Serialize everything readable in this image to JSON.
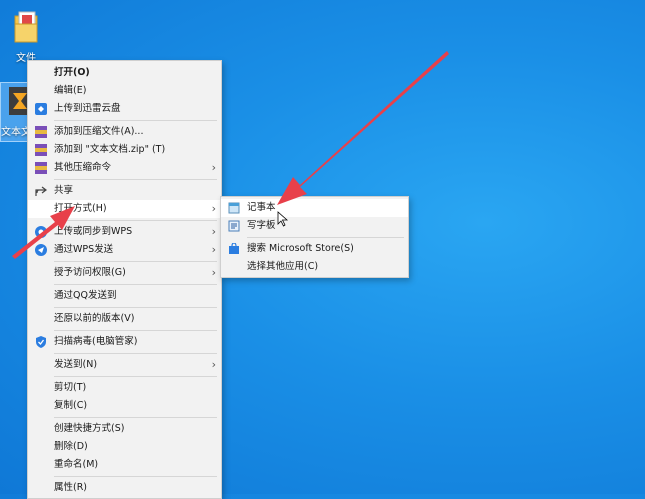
{
  "desktop": {
    "icon1_label": "文件",
    "icon2_label": "文本文"
  },
  "context_menu": {
    "items": [
      {
        "label": "打开(O)",
        "bold": true
      },
      {
        "label": "编辑(E)"
      },
      {
        "label": "上传到迅雷云盘"
      },
      {
        "label": "添加到压缩文件(A)..."
      },
      {
        "label": "添加到 \"文本文档.zip\" (T)"
      },
      {
        "label": "其他压缩命令"
      },
      {
        "label": "共享"
      },
      {
        "label": "打开方式(H)"
      },
      {
        "label": "上传或同步到WPS"
      },
      {
        "label": "通过WPS发送"
      },
      {
        "label": "授予访问权限(G)"
      },
      {
        "label": "通过QQ发送到"
      },
      {
        "label": "还原以前的版本(V)"
      },
      {
        "label": "扫描病毒(电脑管家)"
      },
      {
        "label": "发送到(N)"
      },
      {
        "label": "剪切(T)"
      },
      {
        "label": "复制(C)"
      },
      {
        "label": "创建快捷方式(S)"
      },
      {
        "label": "删除(D)"
      },
      {
        "label": "重命名(M)"
      },
      {
        "label": "属性(R)"
      }
    ]
  },
  "submenu": {
    "items": [
      {
        "label": "记事本"
      },
      {
        "label": "写字板"
      },
      {
        "label": "搜索 Microsoft Store(S)"
      },
      {
        "label": "选择其他应用(C)"
      }
    ]
  },
  "colors": {
    "arrow": "#e8404a",
    "menu_bg": "#f2f2f2",
    "desktop_blue": "#1a8fe6"
  }
}
